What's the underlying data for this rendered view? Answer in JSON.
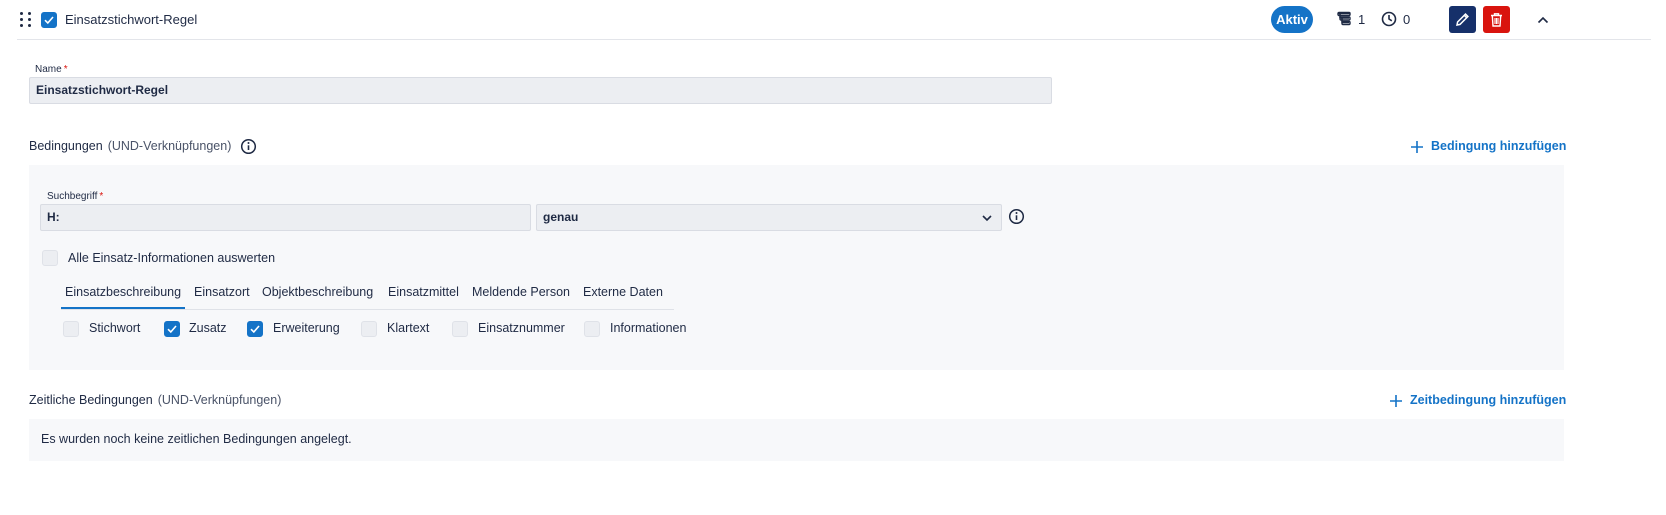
{
  "header": {
    "title": "Einsatzstichwort-Regel",
    "enabled": true,
    "status_badge": "Aktiv",
    "conditions_count": "1",
    "time_conditions_count": "0"
  },
  "name_field": {
    "label": "Name",
    "required_mark": "*",
    "value": "Einsatzstichwort-Regel"
  },
  "conditions": {
    "title": "Bedingungen",
    "subtitle": "(UND-Verknüpfungen)",
    "add_label": "Bedingung hinzufügen",
    "search_term": {
      "label": "Suchbegriff",
      "required_mark": "*",
      "value": "H:"
    },
    "match_mode": {
      "selected": "genau"
    },
    "evaluate_all": {
      "label": "Alle Einsatz-Informationen auswerten",
      "checked": false
    },
    "tabs": [
      {
        "label": "Einsatzbeschreibung",
        "active": true
      },
      {
        "label": "Einsatzort",
        "active": false
      },
      {
        "label": "Objektbeschreibung",
        "active": false
      },
      {
        "label": "Einsatzmittel",
        "active": false
      },
      {
        "label": "Meldende Person",
        "active": false
      },
      {
        "label": "Externe Daten",
        "active": false
      }
    ],
    "fields": [
      {
        "label": "Stichwort",
        "checked": false
      },
      {
        "label": "Zusatz",
        "checked": true
      },
      {
        "label": "Erweiterung",
        "checked": true
      },
      {
        "label": "Klartext",
        "checked": false
      },
      {
        "label": "Einsatznummer",
        "checked": false
      },
      {
        "label": "Informationen",
        "checked": false
      }
    ]
  },
  "time_conditions": {
    "title": "Zeitliche Bedingungen",
    "subtitle": "(UND-Verknüpfungen)",
    "add_label": "Zeitbedingung hinzufügen",
    "empty_message": "Es wurden noch keine zeitlichen Bedingungen angelegt."
  },
  "colors": {
    "accent": "#1473c7",
    "edit_button": "#16306a",
    "delete_button": "#d9140e",
    "required": "#d9140e"
  }
}
